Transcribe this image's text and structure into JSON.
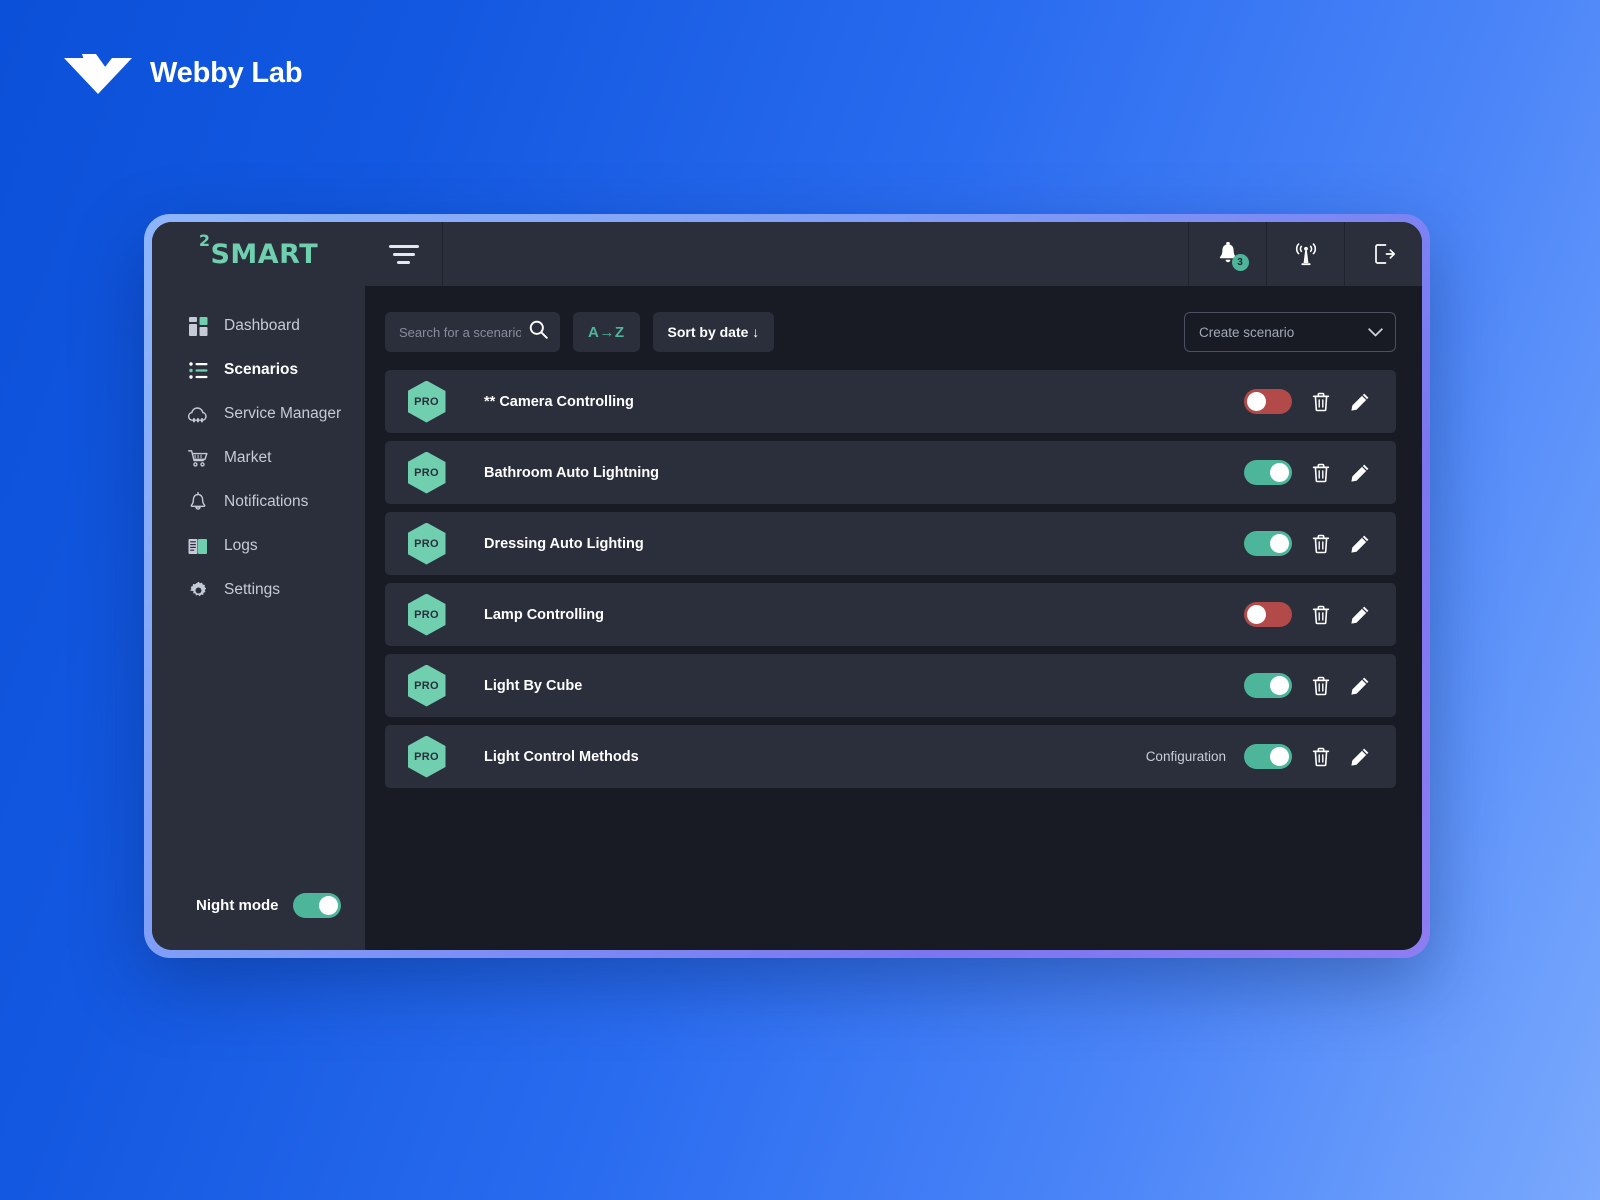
{
  "brand": {
    "name": "Webby Lab",
    "logo_icon": "webby-lab-chevrons-icon"
  },
  "app": {
    "logo_sup": "2",
    "logo_text": "SMART",
    "accent_green": "#4db69a",
    "accent_mint": "#6fcfae",
    "danger_red": "#b34a4a",
    "panel_bg": "#2b2f3c",
    "content_bg": "#181b24"
  },
  "topbar": {
    "menu_icon": "hamburger-menu-icon",
    "actions": [
      {
        "icon": "bell-icon",
        "name": "notifications-button",
        "badge": "3"
      },
      {
        "icon": "antenna-signal-icon",
        "name": "connectivity-button",
        "badge": ""
      },
      {
        "icon": "logout-icon",
        "name": "logout-button",
        "badge": ""
      }
    ]
  },
  "sidebar": {
    "items": [
      {
        "label": "Dashboard",
        "icon": "grid-dashboard-icon",
        "active": false
      },
      {
        "label": "Scenarios",
        "icon": "list-checklist-icon",
        "active": true
      },
      {
        "label": "Service Manager",
        "icon": "cloud-gear-icon",
        "active": false
      },
      {
        "label": "Market",
        "icon": "shopping-cart-icon",
        "active": false
      },
      {
        "label": "Notifications",
        "icon": "bell-icon",
        "active": false
      },
      {
        "label": "Logs",
        "icon": "book-icon",
        "active": false
      },
      {
        "label": "Settings",
        "icon": "gear-icon",
        "active": false
      }
    ],
    "night_mode": {
      "label": "Night mode",
      "enabled": true
    }
  },
  "toolbar": {
    "search_placeholder": "Search for a scenario",
    "search_value": "",
    "search_icon": "search-icon",
    "sort_alpha_label": "A→Z",
    "sort_date_label": "Sort by date ↓",
    "create_scenario_label": "Create scenario",
    "create_scenario_caret": "chevron-down-icon"
  },
  "scenarios": [
    {
      "badge": "PRO",
      "name": "** Camera Controlling",
      "enabled": false,
      "config_label": ""
    },
    {
      "badge": "PRO",
      "name": "Bathroom Auto Lightning",
      "enabled": true,
      "config_label": ""
    },
    {
      "badge": "PRO",
      "name": "Dressing Auto Lighting",
      "enabled": true,
      "config_label": ""
    },
    {
      "badge": "PRO",
      "name": "Lamp Controlling",
      "enabled": false,
      "config_label": ""
    },
    {
      "badge": "PRO",
      "name": "Light By Cube",
      "enabled": true,
      "config_label": ""
    },
    {
      "badge": "PRO",
      "name": "Light Control Methods",
      "enabled": true,
      "config_label": "Configuration"
    }
  ],
  "row_icons": {
    "delete": "trash-icon",
    "edit": "pencil-icon",
    "toggle": "toggle-switch"
  }
}
